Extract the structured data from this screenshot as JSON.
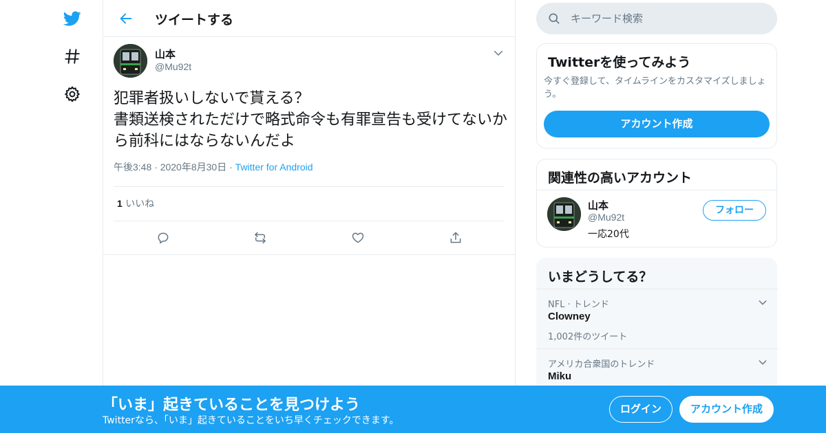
{
  "colors": {
    "brand": "#1da1f2",
    "text": "#14171a",
    "muted": "#657786",
    "border": "#e6ecf0"
  },
  "nav": {
    "icons": [
      "twitter-bird-icon",
      "hashtag-icon",
      "gear-icon"
    ]
  },
  "header": {
    "title": "ツイートする"
  },
  "tweet": {
    "author_name": "山本",
    "author_handle": "@Mu92t",
    "text": "犯罪者扱いしないで貰える？\n書類送検されただけで略式命令も有罪宣告も受けてないから前科にはならないんだよ",
    "time": "午後3:48",
    "date": "2020年8月30日",
    "source": "Twitter for Android",
    "like_count": "1",
    "like_label": "いいね"
  },
  "search": {
    "placeholder": "キーワード検索"
  },
  "signup_card": {
    "title": "Twitterを使ってみよう",
    "desc": "今すぐ登録して、タイムラインをカスタマイズしましょう。",
    "button": "アカウント作成"
  },
  "related": {
    "title": "関連性の高いアカウント",
    "name": "山本",
    "handle": "@Mu92t",
    "bio": "一応20代",
    "follow": "フォロー"
  },
  "trends": {
    "title": "いまどうしてる？",
    "items": [
      {
        "category": "NFL · トレンド",
        "name": "Clowney",
        "count": "1,002件のツイート"
      },
      {
        "category": "アメリカ合衆国のトレンド",
        "name": "Miku",
        "count": ""
      }
    ]
  },
  "banner": {
    "headline": "「いま」起きていることを見つけよう",
    "sub": "Twitterなら、「いま」起きていることをいち早くチェックできます。",
    "login": "ログイン",
    "signup": "アカウント作成"
  }
}
